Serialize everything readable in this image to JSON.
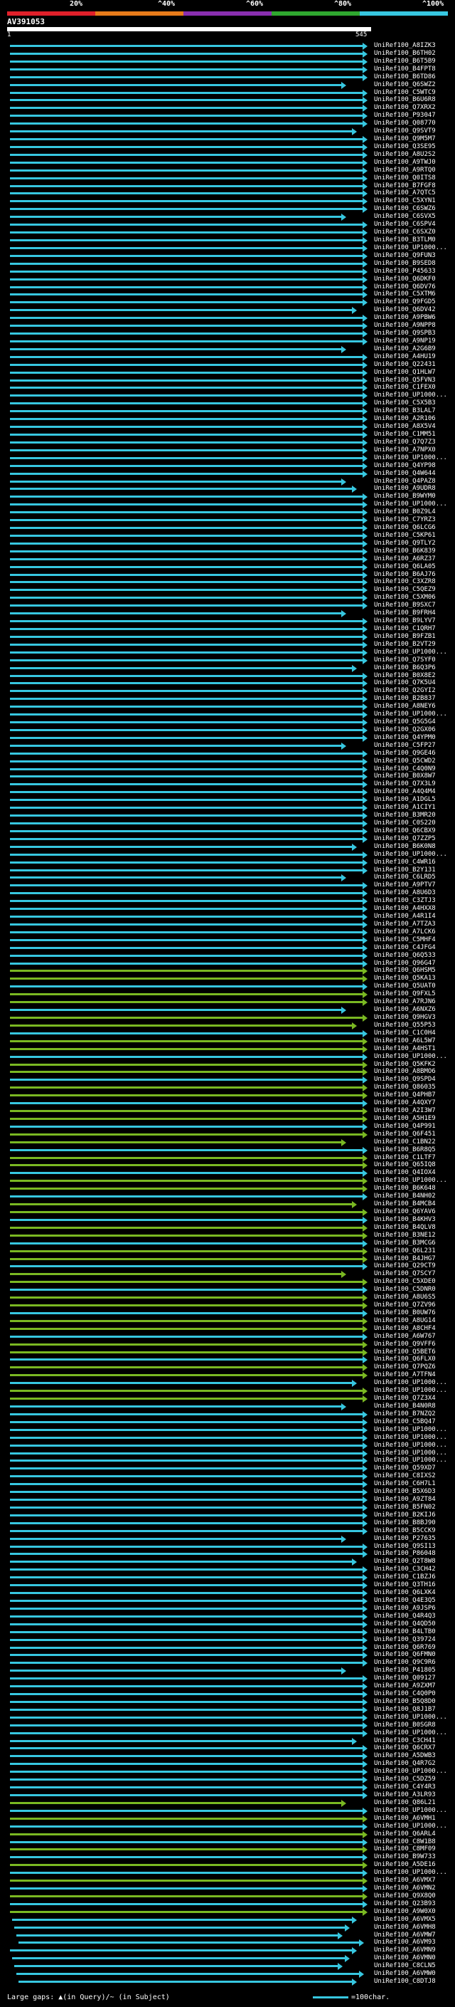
{
  "scale": {
    "labels": [
      "20%",
      "^40%",
      "^60%",
      "^80%",
      "^100%"
    ],
    "colors": [
      "#e0202a",
      "#e87b1a",
      "#8a2fb0",
      "#2fa82f",
      "#37c7e0"
    ]
  },
  "query": {
    "title": "AV391053",
    "start": "1",
    "end": "545"
  },
  "colors": {
    "high": "#37c7e0",
    "mid": "#7ab822"
  },
  "hits": [
    "UniRef100_A8IZK3",
    "UniRef100_B6TH02",
    "UniRef100_B6T5B9",
    "UniRef100_B4FPT8",
    "UniRef100_B6TD86",
    "UniRef100_Q6SWZ2",
    "UniRef100_C5WTC9",
    "UniRef100_B6U6R8",
    "UniRef100_Q7XRX2",
    "UniRef100_P93047",
    "UniRef100_Q08770",
    "UniRef100_Q9SVT9",
    "UniRef100_Q9M5M7",
    "UniRef100_Q3SE95",
    "UniRef100_A8U2S2",
    "UniRef100_A9TWJ0",
    "UniRef100_A9RTQ0",
    "UniRef100_Q0ITS8",
    "UniRef100_B7FGF8",
    "UniRef100_A7QTC5",
    "UniRef100_C5XYN1",
    "UniRef100_C6SWZ6",
    "UniRef100_C6SVX5",
    "UniRef100_C6SPV4",
    "UniRef100_C6SXZ0",
    "UniRef100_B3TLM0",
    "UniRef100_UP1000...",
    "UniRef100_Q9FUN3",
    "UniRef100_B9SED8",
    "UniRef100_P45633",
    "UniRef100_Q6DKF0",
    "UniRef100_Q6DV76",
    "UniRef100_C5XTM6",
    "UniRef100_Q9FGD5",
    "UniRef100_Q6DV42",
    "UniRef100_A9PBW6",
    "UniRef100_A9NPP8",
    "UniRef100_Q9SPB3",
    "UniRef100_A9NP19",
    "UniRef100_A2G6B9",
    "UniRef100_A4HU19",
    "UniRef100_Q22431",
    "UniRef100_Q1HLW7",
    "UniRef100_Q5FVN3",
    "UniRef100_C1FEX0",
    "UniRef100_UP1000...",
    "UniRef100_C5X5B3",
    "UniRef100_B3LAL7",
    "UniRef100_A2R106",
    "UniRef100_A8X5V4",
    "UniRef100_C1MM51",
    "UniRef100_Q7Q7Z3",
    "UniRef100_A7NPX0",
    "UniRef100_UP1000...",
    "UniRef100_Q4YP98",
    "UniRef100_Q4W644",
    "UniRef100_Q4PAZ8",
    "UniRef100_A9UDR8",
    "UniRef100_B9WYM0",
    "UniRef100_UP1000...",
    "UniRef100_B0Z9L4",
    "UniRef100_C7YRZ3",
    "UniRef100_Q6LCG6",
    "UniRef100_C5KP61",
    "UniRef100_Q9TLY2",
    "UniRef100_B6K839",
    "UniRef100_A6RZ37",
    "UniRef100_Q6LA05",
    "UniRef100_B6AJ76",
    "UniRef100_C3XZR8",
    "UniRef100_C5QEZ9",
    "UniRef100_C5XM06",
    "UniRef100_B9SXC7",
    "UniRef100_B9FRH4",
    "UniRef100_B9LYV7",
    "UniRef100_C1QRH7",
    "UniRef100_B9FZB1",
    "UniRef100_B2VT29",
    "UniRef100_UP1000...",
    "UniRef100_Q7SYF0",
    "UniRef100_B6Q3P6",
    "UniRef100_B0X8E2",
    "UniRef100_Q7K5U4",
    "UniRef100_Q2GYI2",
    "UniRef100_B2B837",
    "UniRef100_A8NEY6",
    "UniRef100_UP1000...",
    "UniRef100_Q5G5G4",
    "UniRef100_Q2GX06",
    "UniRef100_Q4YPM0",
    "UniRef100_C5FP27",
    "UniRef100_Q9GE46",
    "UniRef100_Q5CWD2",
    "UniRef100_C4Q0N9",
    "UniRef100_B0X8W7",
    "UniRef100_Q7X3L9",
    "UniRef100_A4Q4M4",
    "UniRef100_A1DGL5",
    "UniRef100_A1CIY1",
    "UniRef100_B3MR20",
    "UniRef100_C0S220",
    "UniRef100_Q6CBX9",
    "UniRef100_Q7ZZP5",
    "UniRef100_B6K0N8",
    "UniRef100_UP1000...",
    "UniRef100_C4WR16",
    "UniRef100_B2Y131",
    "UniRef100_C6LRD5",
    "UniRef100_A9PTV7",
    "UniRef100_A8U6D3",
    "UniRef100_C3ZTJ3",
    "UniRef100_A4HXX8",
    "UniRef100_A4R1I4",
    "UniRef100_A7TZA3",
    "UniRef100_A7LCK6",
    "UniRef100_C5MHF4",
    "UniRef100_C4JFG4",
    "UniRef100_Q6Q533",
    "UniRef100_Q96G47",
    "UniRef100_Q6HSM5",
    "UniRef100_Q5KA13",
    "UniRef100_Q5UAT0",
    "UniRef100_Q9FXL5",
    "UniRef100_A7RJN6",
    "UniRef100_A6NXZ6",
    "UniRef100_Q9HGV3",
    "UniRef100_Q55P53",
    "UniRef100_C1C0H4",
    "UniRef100_A6L5W7",
    "UniRef100_A4HST1",
    "UniRef100_UP1000...",
    "UniRef100_Q5KFK2",
    "UniRef100_A8BMO6",
    "UniRef100_Q9SPD4",
    "UniRef100_Q86035",
    "UniRef100_Q4PHB7",
    "UniRef100_A4QXY7",
    "UniRef100_A2I3W7",
    "UniRef100_A5H1E9",
    "UniRef100_Q4P991",
    "UniRef100_Q6F451",
    "UniRef100_C1BN22",
    "UniRef100_B6R8Q5",
    "UniRef100_C1LTF7",
    "UniRef100_Q65IQ8",
    "UniRef100_Q4IOX4",
    "UniRef100_UP1000...",
    "UniRef100_B6K648",
    "UniRef100_B4NH02",
    "UniRef100_B4MCB4",
    "UniRef100_Q6YAV6",
    "UniRef100_B4KHV3",
    "UniRef100_B4QLV8",
    "UniRef100_B3NE12",
    "UniRef100_B3MCG6",
    "UniRef100_Q6L231",
    "UniRef100_B4JHG7",
    "UniRef100_Q29CT9",
    "UniRef100_Q7SCY7",
    "UniRef100_C5XDE0",
    "UniRef100_C5DNR0",
    "UniRef100_A8U6S5",
    "UniRef100_Q7ZV96",
    "UniRef100_B0UW76",
    "UniRef100_A8UG14",
    "UniRef100_A8CHF4",
    "UniRef100_A6W767",
    "UniRef100_Q9VFF6",
    "UniRef100_Q5BET6",
    "UniRef100_Q6FLX0",
    "UniRef100_Q7PQZ6",
    "UniRef100_A7TFN4",
    "UniRef100_UP1000...",
    "UniRef100_UP1000...",
    "UniRef100_Q7Z3X4",
    "UniRef100_B4N0R8",
    "UniRef100_B7NZQ2",
    "UniRef100_C5BQ47",
    "UniRef100_UP1000...",
    "UniRef100_UP1000...",
    "UniRef100_UP1000...",
    "UniRef100_UP1000...",
    "UniRef100_UP1000...",
    "UniRef100_Q59XD7",
    "UniRef100_C8IXS2",
    "UniRef100_C6H7L1",
    "UniRef100_B5X6D3",
    "UniRef100_A9ZT84",
    "UniRef100_B5FN02",
    "UniRef100_B2KIJ6",
    "UniRef100_B8BJ90",
    "UniRef100_B5CCK9",
    "UniRef100_P27635",
    "UniRef100_Q9SI13",
    "UniRef100_P86048",
    "UniRef100_Q2T8W8",
    "UniRef100_C3CH42",
    "UniRef100_C1BZJ6",
    "UniRef100_Q3TH16",
    "UniRef100_Q6LXK4",
    "UniRef100_Q4E3Q5",
    "UniRef100_A9JSP6",
    "UniRef100_Q4R4Q3",
    "UniRef100_Q4QD50",
    "UniRef100_B4LTB0",
    "UniRef100_Q39724",
    "UniRef100_Q6R769",
    "UniRef100_Q6FMN0",
    "UniRef100_Q9C9R6",
    "UniRef100_P41805",
    "UniRef100_Q09127",
    "UniRef100_A9ZXM7",
    "UniRef100_C4Q0P0",
    "UniRef100_B5Q8D0",
    "UniRef100_Q8J1B7",
    "UniRef100_UP1000...",
    "UniRef100_B0SGR8",
    "UniRef100_UP1000...",
    "UniRef100_C3CH41",
    "UniRef100_Q6CRX7",
    "UniRef100_A5DWB3",
    "UniRef100_Q4R7G2",
    "UniRef100_UP1000...",
    "UniRef100_C5DZ59",
    "UniRef100_C4Y4R3",
    "UniRef100_A3LR93",
    "UniRef100_Q86L21",
    "UniRef100_UP1000...",
    "UniRef100_A6VMH1",
    "UniRef100_UP1000...",
    "UniRef100_Q6ARL4",
    "UniRef100_C8W1B8",
    "UniRef100_C8MF09",
    "UniRef100_B9W733",
    "UniRef100_A5DE16",
    "UniRef100_UP1000...",
    "UniRef100_A6VMX7",
    "UniRef100_A6VMN2",
    "UniRef100_Q9X8Q0",
    "UniRef100_Q23B93",
    "UniRef100_A9W0X0",
    "UniRef100_A6VMX5",
    "UniRef100_A6VMH8",
    "UniRef100_A6VMW7",
    "UniRef100_A6VM93",
    "UniRef100_A6VMN9",
    "UniRef100_A6VMN0",
    "UniRef100_C8CLN5",
    "UniRef100_A6VMW0",
    "UniRef100_C8DTJ8"
  ],
  "footer": {
    "gap_legend": "Large gaps: ▲(in Query)/~ (in Subject)",
    "scale_legend": "=100char."
  }
}
